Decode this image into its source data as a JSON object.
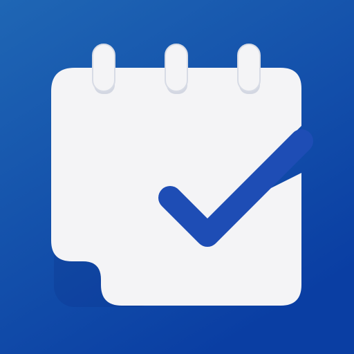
{
  "icon": {
    "name": "calendar-check-icon",
    "colors": {
      "background_top": "#1f66b4",
      "background_bottom": "#0a3ea3",
      "card": "#f4f4f6",
      "card_shadow": "#c9cfdc",
      "check": "#1e4db5"
    }
  }
}
